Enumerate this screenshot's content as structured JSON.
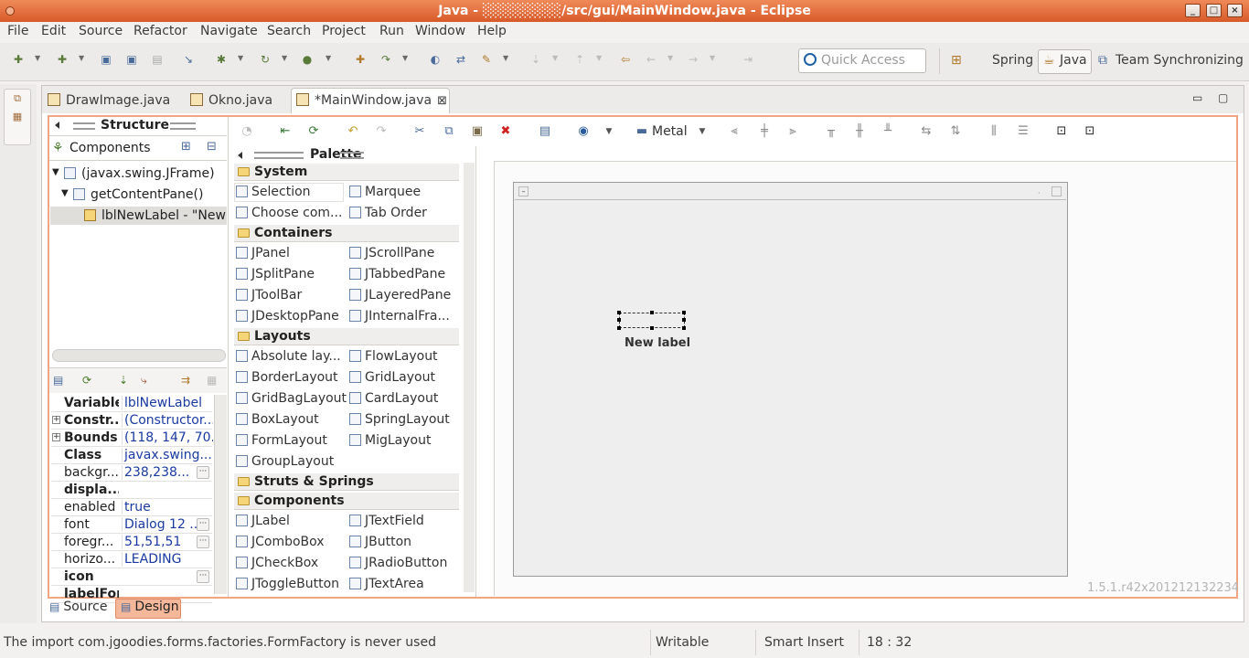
{
  "window": {
    "title": "Java - ░░░░░░░░/src/gui/MainWindow.java - Eclipse"
  },
  "menu": [
    "File",
    "Edit",
    "Source",
    "Refactor",
    "Navigate",
    "Search",
    "Project",
    "Run",
    "Window",
    "Help"
  ],
  "quick_access": {
    "placeholder": "Quick Access"
  },
  "perspectives": [
    "Spring",
    "Java",
    "Team Synchronizing"
  ],
  "tabs": [
    {
      "label": "DrawImage.java",
      "active": false
    },
    {
      "label": "Okno.java",
      "active": false
    },
    {
      "label": "*MainWindow.java",
      "active": true
    }
  ],
  "structure": {
    "title": "Structure",
    "components_label": "Components",
    "tree": [
      "(javax.swing.JFrame)",
      "getContentPane()",
      "lblNewLabel - \"New l"
    ]
  },
  "properties": [
    {
      "name": "Variable",
      "value": "lblNewLabel",
      "bold": true,
      "expand": false,
      "btn": false
    },
    {
      "name": "Constr...",
      "value": "(Constructor...",
      "bold": true,
      "expand": true,
      "btn": false
    },
    {
      "name": "Bounds",
      "value": "(118, 147, 70...",
      "bold": true,
      "expand": true,
      "btn": false
    },
    {
      "name": "Class",
      "value": "javax.swing....",
      "bold": true,
      "expand": false,
      "btn": false
    },
    {
      "name": "backgr...",
      "value": "238,238...",
      "bold": false,
      "expand": false,
      "btn": true
    },
    {
      "name": "displa...",
      "value": "",
      "bold": true,
      "expand": false,
      "btn": false
    },
    {
      "name": "enabled",
      "value": "true",
      "bold": false,
      "expand": false,
      "btn": false
    },
    {
      "name": "font",
      "value": "Dialog 12 ...",
      "bold": false,
      "expand": false,
      "btn": true
    },
    {
      "name": "foregr...",
      "value": "51,51,51",
      "bold": false,
      "expand": false,
      "btn": true
    },
    {
      "name": "horizo...",
      "value": "LEADING",
      "bold": false,
      "expand": false,
      "btn": false
    },
    {
      "name": "icon",
      "value": "",
      "bold": true,
      "expand": false,
      "btn": true
    },
    {
      "name": "labelFor",
      "value": "",
      "bold": true,
      "expand": false,
      "btn": false
    }
  ],
  "design_toolbar": {
    "look_and_feel": "Metal"
  },
  "palette": {
    "title": "Palette",
    "categories": {
      "system": "System",
      "containers": "Containers",
      "layouts": "Layouts",
      "struts": "Struts & Springs",
      "components": "Components"
    },
    "system": [
      "Selection",
      "Marquee",
      "Choose com...",
      "Tab Order"
    ],
    "containers": [
      "JPanel",
      "JScrollPane",
      "JSplitPane",
      "JTabbedPane",
      "JToolBar",
      "JLayeredPane",
      "JDesktopPane",
      "JInternalFra..."
    ],
    "layouts": [
      "Absolute lay...",
      "FlowLayout",
      "BorderLayout",
      "GridLayout",
      "GridBagLayout",
      "CardLayout",
      "BoxLayout",
      "SpringLayout",
      "FormLayout",
      "MigLayout",
      "GroupLayout"
    ],
    "components": [
      "JLabel",
      "JTextField",
      "JComboBox",
      "JButton",
      "JCheckBox",
      "JRadioButton",
      "JToggleButton",
      "JTextArea"
    ]
  },
  "canvas": {
    "label_text": "New label",
    "version": "1.5.1.r42x201212132234"
  },
  "bottom_tabs": {
    "source": "Source",
    "design": "Design"
  },
  "status": {
    "message": "The import com.jgoodies.forms.factories.FormFactory is never used",
    "writable": "Writable",
    "insert_mode": "Smart Insert",
    "position": "18 : 32"
  },
  "colors": {
    "title_bar": "#e4692f",
    "designer_border": "#f1a583",
    "active_design_tab": "#f4b79a"
  }
}
